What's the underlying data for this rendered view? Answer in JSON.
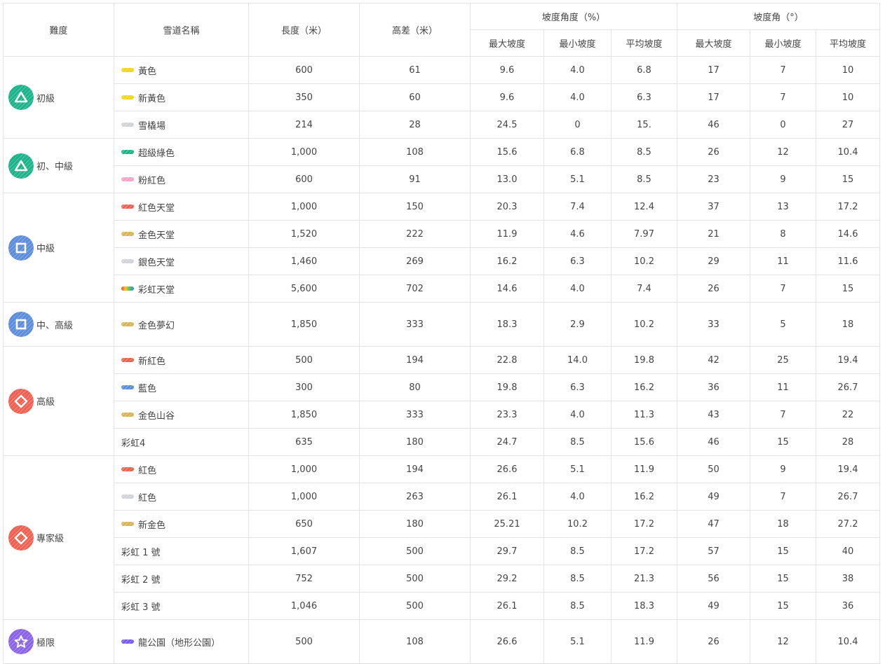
{
  "headers": {
    "difficulty": "難度",
    "trail_name": "雪道名稱",
    "length": "長度（米）",
    "elevation": "高差（米）",
    "slope_percent_group": "坡度角度（%）",
    "slope_angle_group": "坡度角（°）",
    "max_slope": "最大坡度",
    "min_slope": "最小坡度",
    "avg_slope": "平均坡度"
  },
  "colors": {
    "green": "#1ab38a",
    "blue": "#5b8ddb",
    "red": "#ee6152",
    "purple": "#8a63e6",
    "swatch_yellow": "#f3d51d",
    "swatch_green": "#1ab38a",
    "swatch_grey": "#cfd3d8",
    "swatch_pink": "#f2a3c6",
    "swatch_red": "#ee6152",
    "swatch_gold": "#d9b35a",
    "swatch_blue": "#5b8ddb",
    "swatch_purple": "#7a5af0",
    "swatch_rainbow": "rainbow-gradient"
  },
  "groups": [
    {
      "label": "初級",
      "icon": "triangle-icon",
      "color": "green",
      "rows": [
        {
          "name": "黃色",
          "swatch": "swatch_yellow",
          "length": "600",
          "elev": "61",
          "pmax": "9.6",
          "pmin": "4.0",
          "pavg": "6.8",
          "amax": "17",
          "amin": "7",
          "aavg": "10"
        },
        {
          "name": "新黃色",
          "swatch": "swatch_yellow",
          "length": "350",
          "elev": "60",
          "pmax": "9.6",
          "pmin": "4.0",
          "pavg": "6.3",
          "amax": "17",
          "amin": "7",
          "aavg": "10"
        },
        {
          "name": "雪橇場",
          "swatch": "swatch_grey",
          "length": "214",
          "elev": "28",
          "pmax": "24.5",
          "pmin": "0",
          "pavg": "15.",
          "amax": "46",
          "amin": "0",
          "aavg": "27"
        }
      ]
    },
    {
      "label": "初、中級",
      "icon": "triangle-icon",
      "color": "green",
      "rows": [
        {
          "name": "超級綠色",
          "swatch": "swatch_green",
          "length": "1,000",
          "elev": "108",
          "pmax": "15.6",
          "pmin": "6.8",
          "pavg": "8.5",
          "amax": "26",
          "amin": "12",
          "aavg": "10.4"
        },
        {
          "name": "粉紅色",
          "swatch": "swatch_pink",
          "length": "600",
          "elev": "91",
          "pmax": "13.0",
          "pmin": "5.1",
          "pavg": "8.5",
          "amax": "23",
          "amin": "9",
          "aavg": "15"
        }
      ]
    },
    {
      "label": "中級",
      "icon": "square-icon",
      "color": "blue",
      "rows": [
        {
          "name": "紅色天堂",
          "swatch": "swatch_red",
          "length": "1,000",
          "elev": "150",
          "pmax": "20.3",
          "pmin": "7.4",
          "pavg": "12.4",
          "amax": "37",
          "amin": "13",
          "aavg": "17.2"
        },
        {
          "name": "金色天堂",
          "swatch": "swatch_gold",
          "length": "1,520",
          "elev": "222",
          "pmax": "11.9",
          "pmin": "4.6",
          "pavg": "7.97",
          "amax": "21",
          "amin": "8",
          "aavg": "14.6"
        },
        {
          "name": "銀色天堂",
          "swatch": "swatch_grey",
          "length": "1,460",
          "elev": "269",
          "pmax": "16.2",
          "pmin": "6.3",
          "pavg": "10.2",
          "amax": "29",
          "amin": "11",
          "aavg": "11.6"
        },
        {
          "name": "彩虹天堂",
          "swatch": "swatch_rainbow",
          "length": "5,600",
          "elev": "702",
          "pmax": "14.6",
          "pmin": "4.0",
          "pavg": "7.4",
          "amax": "26",
          "amin": "7",
          "aavg": "15"
        }
      ]
    },
    {
      "label": "中、高級",
      "icon": "square-icon",
      "color": "blue",
      "tall": true,
      "rows": [
        {
          "name": "金色夢幻",
          "swatch": "swatch_gold",
          "length": "1,850",
          "elev": "333",
          "pmax": "18.3",
          "pmin": "2.9",
          "pavg": "10.2",
          "amax": "33",
          "amin": "5",
          "aavg": "18"
        }
      ]
    },
    {
      "label": "高級",
      "icon": "diamond-icon",
      "color": "red",
      "rows": [
        {
          "name": "新紅色",
          "swatch": "swatch_red",
          "length": "500",
          "elev": "194",
          "pmax": "22.8",
          "pmin": "14.0",
          "pavg": "19.8",
          "amax": "42",
          "amin": "25",
          "aavg": "19.4"
        },
        {
          "name": "藍色",
          "swatch": "swatch_blue",
          "length": "300",
          "elev": "80",
          "pmax": "19.8",
          "pmin": "6.3",
          "pavg": "16.2",
          "amax": "36",
          "amin": "11",
          "aavg": "26.7"
        },
        {
          "name": "金色山谷",
          "swatch": "swatch_gold",
          "length": "1,850",
          "elev": "333",
          "pmax": "23.3",
          "pmin": "4.0",
          "pavg": "11.3",
          "amax": "43",
          "amin": "7",
          "aavg": "22"
        },
        {
          "name": "彩虹4",
          "swatch": "",
          "length": "635",
          "elev": "180",
          "pmax": "24.7",
          "pmin": "8.5",
          "pavg": "15.6",
          "amax": "46",
          "amin": "15",
          "aavg": "28"
        }
      ]
    },
    {
      "label": "專家級",
      "icon": "diamond-icon",
      "color": "red",
      "rows": [
        {
          "name": "紅色",
          "swatch": "swatch_red",
          "length": "1,000",
          "elev": "194",
          "pmax": "26.6",
          "pmin": "5.1",
          "pavg": "11.9",
          "amax": "50",
          "amin": "9",
          "aavg": "19.4"
        },
        {
          "name": "紅色",
          "swatch": "swatch_grey",
          "length": "1,000",
          "elev": "263",
          "pmax": "26.1",
          "pmin": "4.0",
          "pavg": "16.2",
          "amax": "49",
          "amin": "7",
          "aavg": "26.7"
        },
        {
          "name": "新金色",
          "swatch": "swatch_gold",
          "length": "650",
          "elev": "180",
          "pmax": "25.21",
          "pmin": "10.2",
          "pavg": "17.2",
          "amax": "47",
          "amin": "18",
          "aavg": "27.2"
        },
        {
          "name": "彩虹 1 號",
          "swatch": "",
          "length": "1,607",
          "elev": "500",
          "pmax": "29.7",
          "pmin": "8.5",
          "pavg": "17.2",
          "amax": "57",
          "amin": "15",
          "aavg": "40"
        },
        {
          "name": "彩虹 2 號",
          "swatch": "",
          "length": "752",
          "elev": "500",
          "pmax": "29.2",
          "pmin": "8.5",
          "pavg": "21.3",
          "amax": "56",
          "amin": "15",
          "aavg": "38"
        },
        {
          "name": "彩虹 3 號",
          "swatch": "",
          "length": "1,046",
          "elev": "500",
          "pmax": "26.1",
          "pmin": "8.5",
          "pavg": "18.3",
          "amax": "49",
          "amin": "15",
          "aavg": "36"
        }
      ]
    },
    {
      "label": "極限",
      "icon": "star-icon",
      "color": "purple",
      "tall": true,
      "rows": [
        {
          "name": "龍公園（地形公園）",
          "swatch": "swatch_purple",
          "length": "500",
          "elev": "108",
          "pmax": "26.6",
          "pmin": "5.1",
          "pavg": "11.9",
          "amax": "26",
          "amin": "12",
          "aavg": "10.4"
        }
      ]
    }
  ]
}
